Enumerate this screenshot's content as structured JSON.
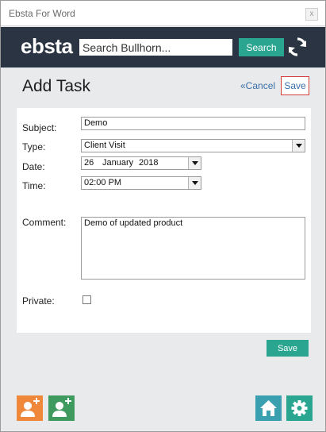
{
  "window": {
    "title": "Ebsta For Word",
    "close_glyph": "x"
  },
  "header": {
    "logo": "ebsta",
    "search_placeholder": "Search Bullhorn...",
    "search_button": "Search",
    "sync_icon": "sync-icon"
  },
  "page": {
    "title": "Add Task",
    "cancel_label": "«Cancel",
    "save_label": "Save"
  },
  "form": {
    "subject_label": "Subject:",
    "subject_value": "Demo",
    "type_label": "Type:",
    "type_value": "Client Visit",
    "date_label": "Date:",
    "date_day": "26",
    "date_month": "January",
    "date_year": "2018",
    "time_label": "Time:",
    "time_value": "02:00 PM",
    "comment_label": "Comment:",
    "comment_value": "Demo of updated product",
    "private_label": "Private:",
    "private_checked": false
  },
  "actions": {
    "save_button": "Save"
  },
  "footer": {
    "left_buttons": [
      "add-contact-icon",
      "add-candidate-icon"
    ],
    "right_buttons": [
      "home-icon",
      "settings-gear-icon"
    ]
  },
  "colors": {
    "header_bg": "#2a3442",
    "accent_teal": "#2aa58f",
    "orange": "#f0883c",
    "green": "#3e9a5e",
    "blue_teal": "#3aa0b0"
  }
}
